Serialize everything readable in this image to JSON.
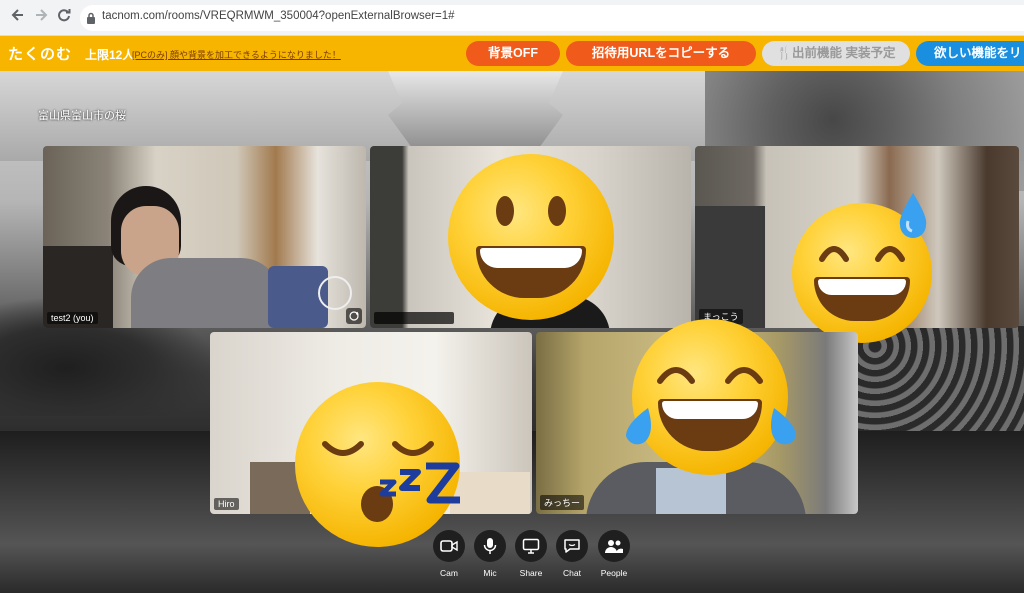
{
  "browser": {
    "url": "tacnom.com/rooms/VREQRMWM_350004?openExternalBrowser=1#",
    "icons": [
      "back-arrow-icon",
      "forward-arrow-icon",
      "reload-icon",
      "lock-icon"
    ]
  },
  "header": {
    "logo": "たくのむ",
    "limit": "上限12人",
    "notice": "[PCのみ] 顔や背景を加工できるようになりました！",
    "buttons": {
      "bg_off": "背景OFF",
      "copy_url": "招待用URLをコピーする",
      "delivery": "🍴出前機能 実装予定",
      "request": "欲しい機能をリ"
    },
    "colors": {
      "bar": "#f7b500",
      "orange": "#f05a1a",
      "blue": "#1a8fe0",
      "disabled": "#e0e0e0"
    }
  },
  "background": {
    "caption": "富山県富山市の桜"
  },
  "tiles": {
    "t1": {
      "name": "test2 (you)"
    },
    "t2": {
      "name": ""
    },
    "t3": {
      "name": "まっこう"
    },
    "t4": {
      "name": "Hiro"
    },
    "t5": {
      "name": "みっちー"
    }
  },
  "emojis": [
    "grinning-face",
    "grinning-face-with-sweat",
    "sleeping-face",
    "face-with-tears-of-joy"
  ],
  "toolbar": {
    "cam": "Cam",
    "mic": "Mic",
    "share": "Share",
    "chat": "Chat",
    "people": "People"
  }
}
